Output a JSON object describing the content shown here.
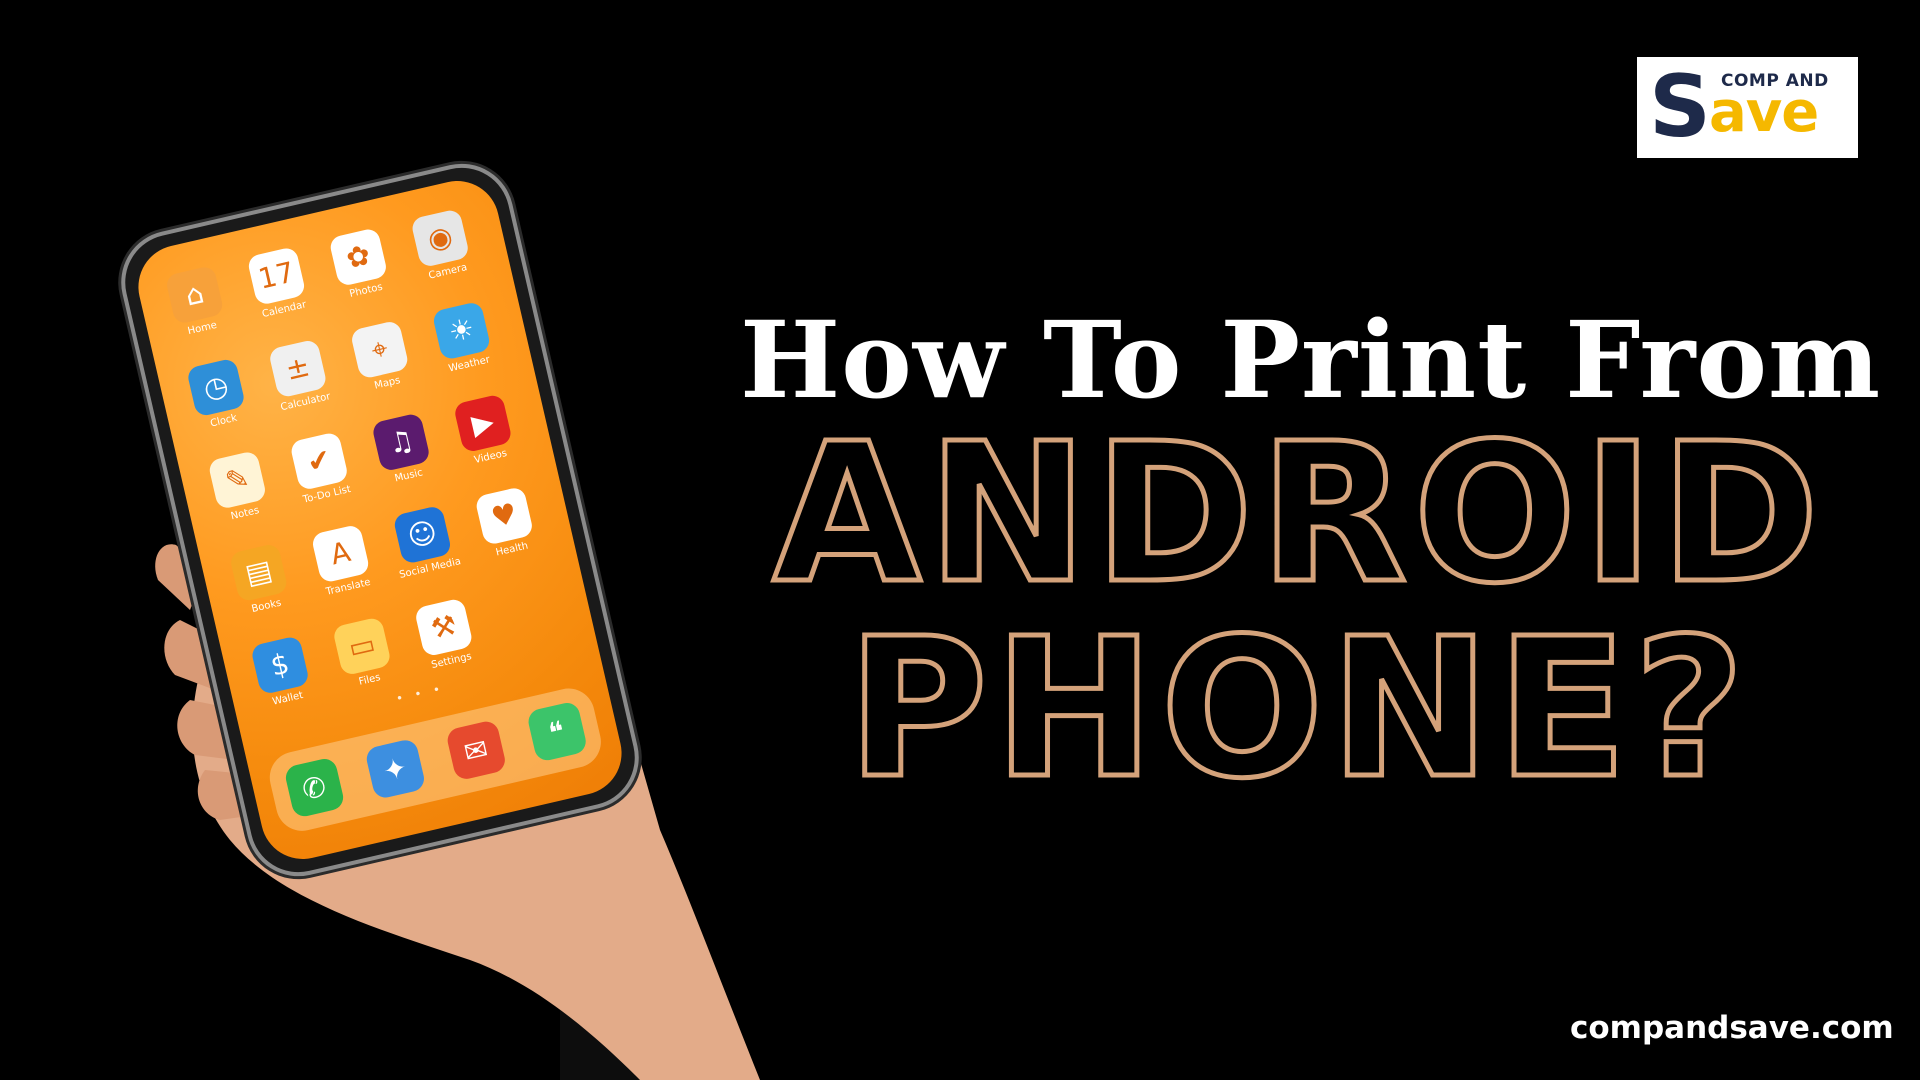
{
  "logo": {
    "top_text": "COMP AND",
    "brand_s": "S",
    "brand_rest": "ave"
  },
  "headline": {
    "line1": "How To Print From",
    "line2": "ANDROID",
    "line3": "PHONE?"
  },
  "site_url": "compandsave.com",
  "colors": {
    "background": "#000000",
    "headline_outline": "#d4a27a",
    "logo_navy": "#1e2a4a",
    "logo_yellow": "#f5b800",
    "screen_orange": "#f58a0c"
  },
  "phone": {
    "apps": [
      {
        "label": "Home",
        "icon": "home-icon",
        "glyph": "⌂",
        "color": "#f7a13a"
      },
      {
        "label": "Calendar",
        "icon": "calendar-icon",
        "glyph": "17",
        "color": "#ffffff"
      },
      {
        "label": "Photos",
        "icon": "photos-icon",
        "glyph": "✿",
        "color": "#ffffff"
      },
      {
        "label": "Camera",
        "icon": "camera-icon",
        "glyph": "◉",
        "color": "#e6e6e6"
      },
      {
        "label": "Clock",
        "icon": "clock-icon",
        "glyph": "◷",
        "color": "#2e8fd8"
      },
      {
        "label": "Calculator",
        "icon": "calculator-icon",
        "glyph": "±",
        "color": "#f0f0f0"
      },
      {
        "label": "Maps",
        "icon": "maps-icon",
        "glyph": "⌖",
        "color": "#f3f3f3"
      },
      {
        "label": "Weather",
        "icon": "weather-icon",
        "glyph": "☀",
        "color": "#3aa7e8"
      },
      {
        "label": "Notes",
        "icon": "notes-icon",
        "glyph": "✎",
        "color": "#fff4d6"
      },
      {
        "label": "To-Do List",
        "icon": "todo-icon",
        "glyph": "✔",
        "color": "#ffffff"
      },
      {
        "label": "Music",
        "icon": "music-icon",
        "glyph": "♫",
        "color": "#5b1b6e"
      },
      {
        "label": "Videos",
        "icon": "videos-icon",
        "glyph": "▶",
        "color": "#e02020"
      },
      {
        "label": "Books",
        "icon": "books-icon",
        "glyph": "▤",
        "color": "#f5a623"
      },
      {
        "label": "Translate",
        "icon": "translate-icon",
        "glyph": "A",
        "color": "#ffffff"
      },
      {
        "label": "Social Media",
        "icon": "social-media-icon",
        "glyph": "☺",
        "color": "#1f73d6"
      },
      {
        "label": "Health",
        "icon": "health-icon",
        "glyph": "♥",
        "color": "#ffffff"
      },
      {
        "label": "Wallet",
        "icon": "wallet-icon",
        "glyph": "$",
        "color": "#2f8ee0"
      },
      {
        "label": "Files",
        "icon": "files-icon",
        "glyph": "▭",
        "color": "#ffd25a"
      },
      {
        "label": "Settings",
        "icon": "settings-icon",
        "glyph": "⚒",
        "color": "#ffffff"
      }
    ],
    "page_dots": "• • •",
    "dock": [
      {
        "icon": "phone-icon",
        "glyph": "✆",
        "color": "#2bb34a"
      },
      {
        "icon": "compass-icon",
        "glyph": "✦",
        "color": "#3d8fe0"
      },
      {
        "icon": "mail-icon",
        "glyph": "✉",
        "color": "#e64a2e"
      },
      {
        "icon": "messages-icon",
        "glyph": "❝",
        "color": "#3cc46a"
      }
    ]
  }
}
